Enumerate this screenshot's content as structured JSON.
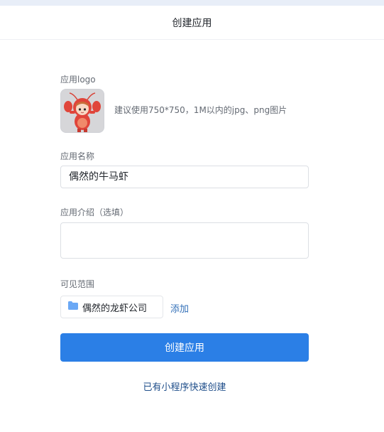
{
  "header": {
    "title": "创建应用"
  },
  "form": {
    "logo_label": "应用logo",
    "logo_hint": "建议使用750*750，1M以内的jpg、png图片",
    "name_label": "应用名称",
    "name_value": "偶然的牛马虾",
    "intro_label": "应用介绍（选填）",
    "intro_value": "",
    "scope_label": "可见范围",
    "scope_item": "偶然的龙虾公司",
    "add_label": "添加",
    "create_label": "创建应用",
    "quick_create_label": "已有小程序快速创建"
  },
  "icons": {
    "scope_item_icon": "folder-icon",
    "logo": "lobster-mascot-image"
  },
  "colors": {
    "primary": "#2b7fe6",
    "link": "#3370b8",
    "folder": "#6aa8f5",
    "mascot": "#e0453a"
  }
}
